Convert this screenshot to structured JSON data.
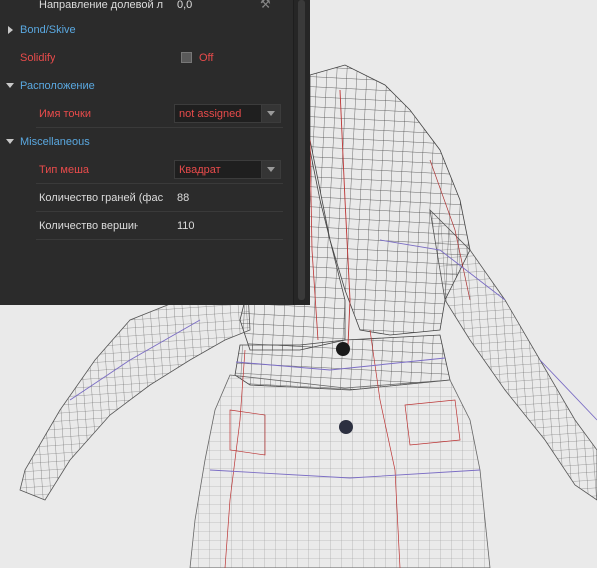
{
  "properties": {
    "row_top": {
      "label": "Направление долевой л",
      "value": "0,0"
    },
    "bond_skive": {
      "label": "Bond/Skive"
    },
    "solidify": {
      "label": "Solidify",
      "state": "Off"
    },
    "placement": {
      "label": "Расположение"
    },
    "point_name": {
      "label": "Имя точки",
      "value": "not assigned"
    },
    "misc": {
      "label": "Miscellaneous"
    },
    "mesh_type": {
      "label": "Тип меша",
      "value": "Квадрат"
    },
    "face_count": {
      "label": "Количество граней (фас",
      "value": "88"
    },
    "vertex_count": {
      "label": "Количество вершин",
      "value": "110"
    }
  },
  "colors": {
    "panel_bg": "#2b2b2b",
    "section": "#5aa8e0",
    "highlight": "#e84b4b",
    "viewport_bg": "#eaeaea"
  },
  "icons": {
    "expand": "triangle-right",
    "collapse": "triangle-down",
    "dropdown": "triangle-down",
    "tool": "wrench"
  }
}
